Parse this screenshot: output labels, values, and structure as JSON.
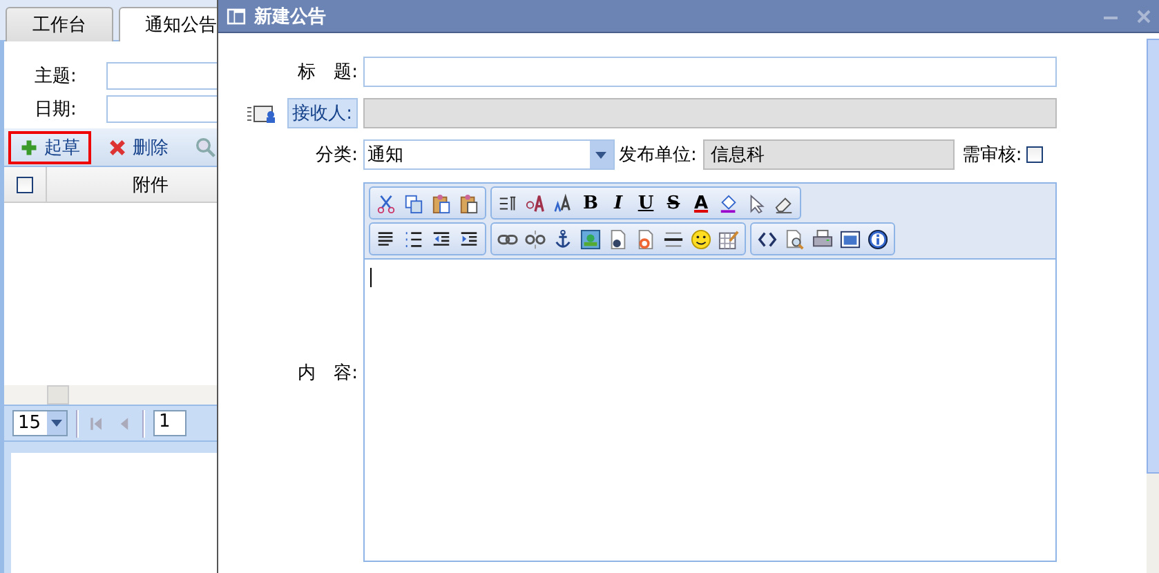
{
  "left_panel": {
    "tabs": [
      {
        "label": "工作台",
        "selected": false
      },
      {
        "label": "通知公告",
        "selected": true
      }
    ],
    "filters": [
      {
        "label": "主题:"
      },
      {
        "label": "日期:"
      }
    ],
    "toolbar": [
      {
        "kind": "add",
        "label": "起草",
        "highlighted": true
      },
      {
        "kind": "delete",
        "label": "删除",
        "highlighted": false
      },
      {
        "kind": "search"
      }
    ],
    "grid": {
      "select_all_checked": false,
      "columns": [
        "附件"
      ]
    },
    "pager": {
      "page_size": "15",
      "page": "1"
    }
  },
  "dialog": {
    "title": "新建公告",
    "title_field": {
      "label": "标　题:"
    },
    "recipient": {
      "label": "接收人:"
    },
    "category": {
      "label": "分类:",
      "value": "通知"
    },
    "publisher": {
      "label": "发布单位:",
      "value": "信息科"
    },
    "review": {
      "label": "需审核:",
      "checked": false
    },
    "content": {
      "label": "内　容:"
    },
    "editor_toolbar": [
      [
        [
          {
            "kind": "cut"
          },
          {
            "kind": "copy"
          },
          {
            "kind": "paste"
          },
          {
            "kind": "paste-text"
          }
        ],
        [
          {
            "kind": "paragraph"
          },
          {
            "kind": "font"
          },
          {
            "kind": "font-size"
          },
          {
            "kind": "bold",
            "label": "B"
          },
          {
            "kind": "italic",
            "label": "I"
          },
          {
            "kind": "underline",
            "label": "U"
          },
          {
            "kind": "strike",
            "label": "S"
          },
          {
            "kind": "text-color",
            "label": "A"
          },
          {
            "kind": "fill-color"
          },
          {
            "kind": "pointer"
          },
          {
            "kind": "eraser"
          }
        ]
      ],
      [
        [
          {
            "kind": "align"
          },
          {
            "kind": "list"
          },
          {
            "kind": "outdent"
          },
          {
            "kind": "indent"
          }
        ],
        [
          {
            "kind": "link"
          },
          {
            "kind": "unlink"
          },
          {
            "kind": "anchor"
          },
          {
            "kind": "image"
          },
          {
            "kind": "flash"
          },
          {
            "kind": "media"
          },
          {
            "kind": "rule"
          },
          {
            "kind": "smiley"
          },
          {
            "kind": "table"
          }
        ],
        [
          {
            "kind": "source"
          },
          {
            "kind": "preview"
          },
          {
            "kind": "print"
          },
          {
            "kind": "window"
          },
          {
            "kind": "info"
          }
        ]
      ]
    ]
  }
}
